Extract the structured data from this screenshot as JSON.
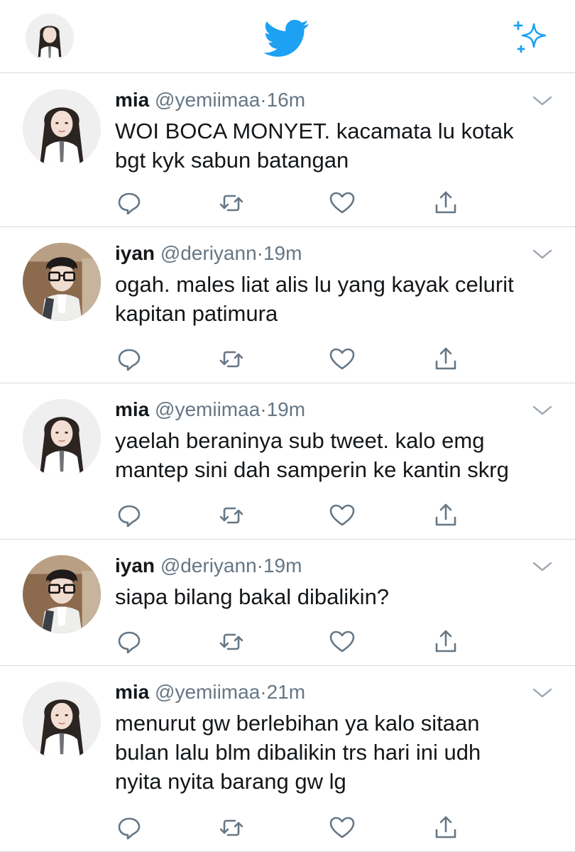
{
  "tweets": [
    {
      "name": "mia",
      "handle": "@yemiimaa",
      "sep": "·",
      "time": "16m",
      "avatar": "mia-avatar",
      "lines": [
        "WOI BOCA MONYET. kacamata lu kotak",
        "bgt kyk sabun batangan"
      ]
    },
    {
      "name": "iyan",
      "handle": "@deriyann",
      "sep": "·",
      "time": "19m",
      "avatar": "iyan-avatar",
      "lines": [
        "ogah. males liat alis lu yang kayak celurit",
        "kapitan patimura"
      ]
    },
    {
      "name": "mia",
      "handle": "@yemiimaa",
      "sep": "·",
      "time": "19m",
      "avatar": "mia-avatar",
      "lines": [
        "yaelah beraninya sub tweet. kalo emg",
        "mantep sini dah samperin ke kantin skrg"
      ]
    },
    {
      "name": "iyan",
      "handle": "@deriyann",
      "sep": "·",
      "time": "19m",
      "avatar": "iyan-avatar",
      "lines": [
        "siapa bilang bakal dibalikin?"
      ]
    },
    {
      "name": "mia",
      "handle": "@yemiimaa",
      "sep": "·",
      "time": "21m",
      "avatar": "mia-avatar",
      "lines": [
        "menurut gw berlebihan ya kalo sitaan",
        "bulan lalu blm dibalikin trs hari ini udh",
        "nyita nyita barang gw lg"
      ]
    }
  ],
  "icons": {
    "header_left": "profile-avatar",
    "header_center": "twitter-bird-logo",
    "header_right": "sparkle-icon",
    "actions": [
      "reply-icon",
      "retweet-icon",
      "like-icon",
      "share-icon"
    ],
    "menu": "chevron-down-icon"
  },
  "colors": {
    "brand": "#1da1f2",
    "text": "#14171a",
    "secondary": "#657786",
    "icon": "#657786",
    "divider": "#d6dbe0"
  }
}
